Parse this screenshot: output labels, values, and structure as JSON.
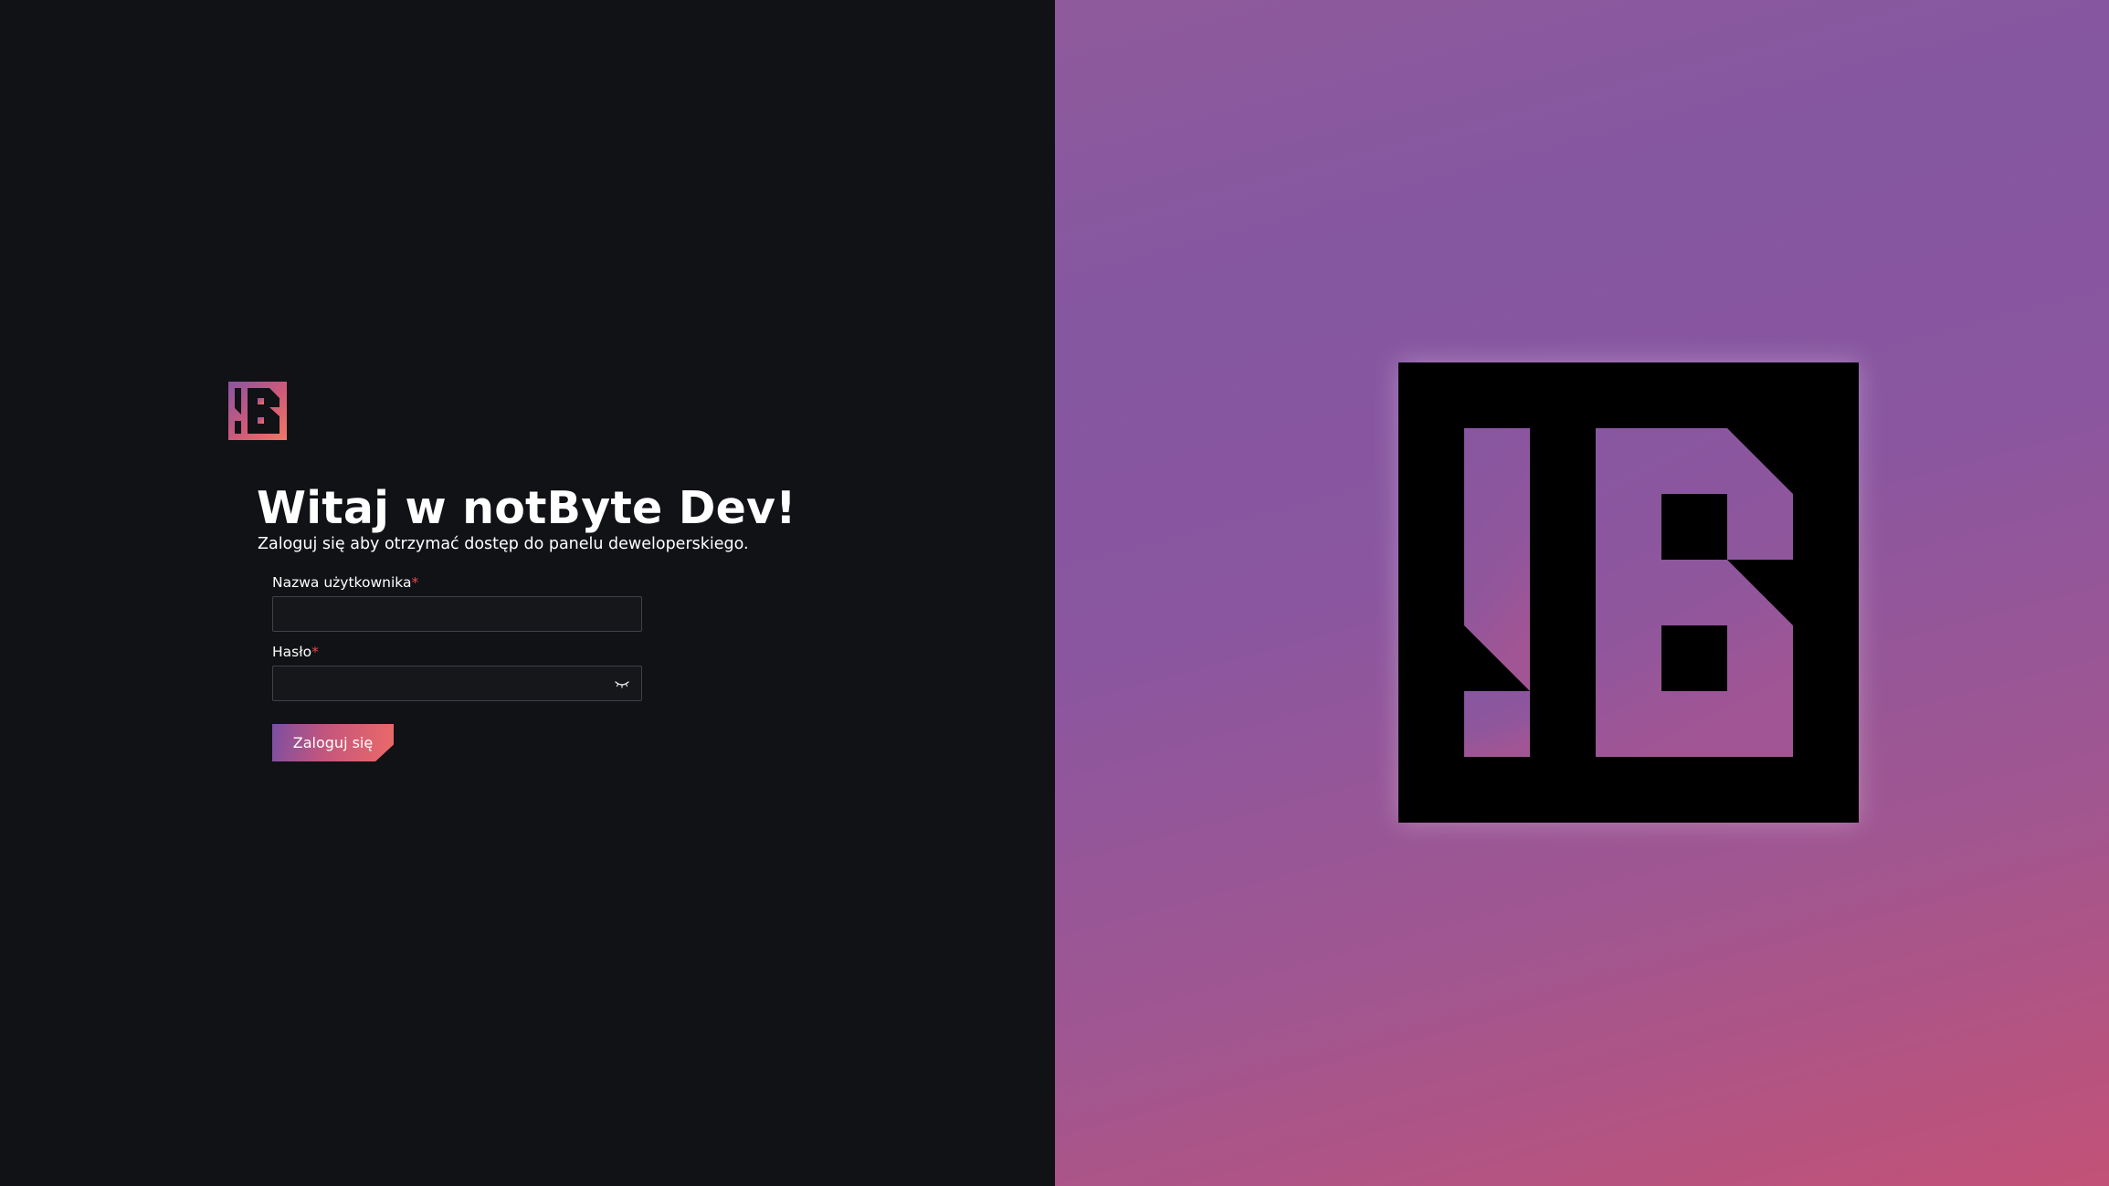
{
  "brand": {
    "logo_icon": "notbyte-logo-icon",
    "colors": {
      "left_background": "#111216",
      "gradient_start": "#8557a1",
      "gradient_end": "#c25277",
      "accent_orange": "#ec6a68",
      "required_marker": "#e5484d"
    }
  },
  "login": {
    "heading": "Witaj w notByte Dev!",
    "subtitle": "Zaloguj się aby otrzymać dostęp do panelu deweloperskiego.",
    "username": {
      "label": "Nazwa użytkownika",
      "required_mark": "*",
      "value": "",
      "placeholder": ""
    },
    "password": {
      "label": "Hasło",
      "required_mark": "*",
      "value": "",
      "placeholder": "",
      "toggle_icon": "eye-closed-icon"
    },
    "submit_label": "Zaloguj się"
  }
}
